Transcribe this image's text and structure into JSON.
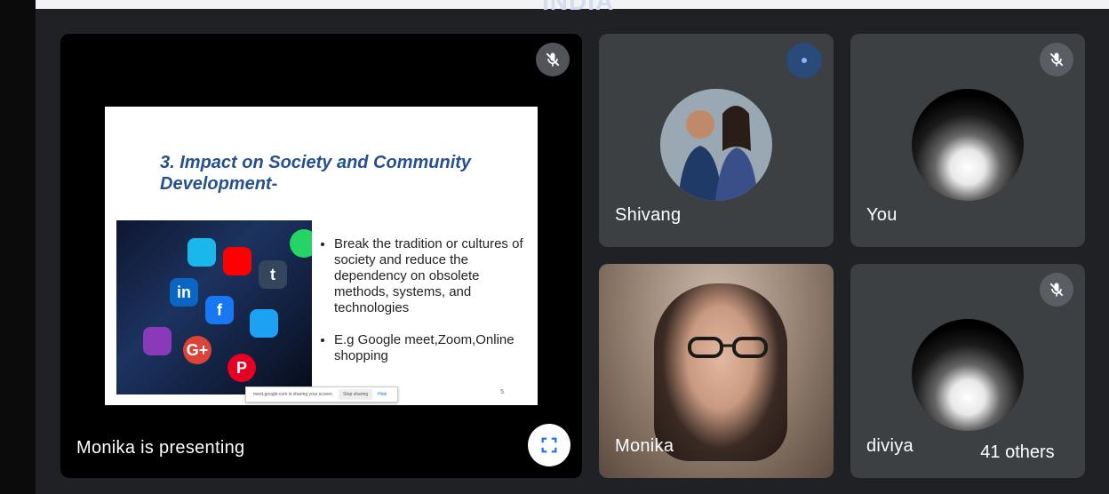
{
  "background_top_text": "INDIA",
  "main_tile": {
    "name": "Monika is presenting",
    "slide": {
      "title": "3. Impact on Society and Community Development-",
      "bullets": [
        "Break the tradition or cultures of society and reduce the dependency on obsolete methods, systems, and technologies",
        "E.g Google meet,Zoom,Online shopping"
      ],
      "share_bar": {
        "text": "meet.google.com is sharing your screen.",
        "stop_label": "Stop sharing",
        "hide_label": "Hide"
      },
      "slide_number": "5",
      "photo_app_labels": [
        "in",
        "f",
        "t",
        "G+",
        "P"
      ]
    }
  },
  "participants": [
    {
      "name": "Shivang",
      "state": "speaking"
    },
    {
      "name": "You",
      "state": "muted"
    },
    {
      "name": "Monika",
      "state": "video"
    },
    {
      "name": "diviya",
      "state": "muted"
    }
  ],
  "others_label": "41 others",
  "colors": {
    "tile_bg": "#3c4043",
    "page_bg": "#202124",
    "slide_title": "#27508f",
    "speaking": "#8ab4f8"
  },
  "icons": [
    "mic-off-icon",
    "speaking-indicator-icon",
    "fullscreen-icon"
  ]
}
